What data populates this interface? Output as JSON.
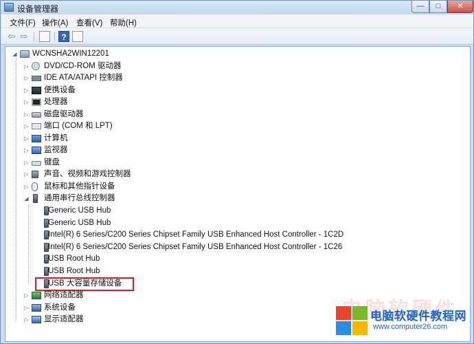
{
  "window": {
    "title": "设备管理器",
    "buttons": {
      "minimize": "—",
      "maximize": "□",
      "close": "✕"
    }
  },
  "menu": [
    "文件(F)",
    "操作(A)",
    "查看(V)",
    "帮助(H)"
  ],
  "toolbar": {
    "back_icon": "⇦",
    "forward_icon": "⇨",
    "help_label": "?"
  },
  "tree": {
    "root": "WCNSHA2WIN12201",
    "categories": [
      {
        "label": "DVD/CD-ROM 驱动器",
        "icon": "disc-icon"
      },
      {
        "label": "IDE ATA/ATAPI 控制器",
        "icon": "ide-icon"
      },
      {
        "label": "便携设备",
        "icon": "portable-icon"
      },
      {
        "label": "处理器",
        "icon": "cpu-icon"
      },
      {
        "label": "磁盘驱动器",
        "icon": "hdd-icon"
      },
      {
        "label": "端口 (COM 和 LPT)",
        "icon": "port-icon"
      },
      {
        "label": "计算机",
        "icon": "computer-icon"
      },
      {
        "label": "监视器",
        "icon": "monitor-icon"
      },
      {
        "label": "键盘",
        "icon": "keyboard-icon"
      },
      {
        "label": "声音、视频和游戏控制器",
        "icon": "speaker-icon"
      },
      {
        "label": "鼠标和其他指针设备",
        "icon": "mouse-icon"
      },
      {
        "label": "通用串行总线控制器",
        "icon": "usb-icon",
        "expanded": true
      }
    ],
    "usb_children": [
      "Generic USB Hub",
      "Generic USB Hub",
      "Intel(R) 6 Series/C200 Series Chipset Family USB Enhanced Host Controller - 1C2D",
      "Intel(R) 6 Series/C200 Series Chipset Family USB Enhanced Host Controller - 1C26",
      "USB Root Hub",
      "USB Root Hub",
      "USB 大容量存储设备"
    ],
    "after": [
      {
        "label": "网络适配器",
        "icon": "network-icon"
      },
      {
        "label": "系统设备",
        "icon": "system-icon"
      },
      {
        "label": "显示适配器",
        "icon": "display-icon"
      }
    ],
    "expanded_glyph": "◢",
    "collapsed_glyph": "▷"
  },
  "watermark": {
    "title": "电脑软硬件教程网",
    "url": "www.computer26.com",
    "background_text": "电脑软硬件",
    "colors": {
      "red": "#e8452c",
      "green": "#7ab828",
      "blue": "#2a8de0",
      "yellow": "#f5b800"
    }
  }
}
